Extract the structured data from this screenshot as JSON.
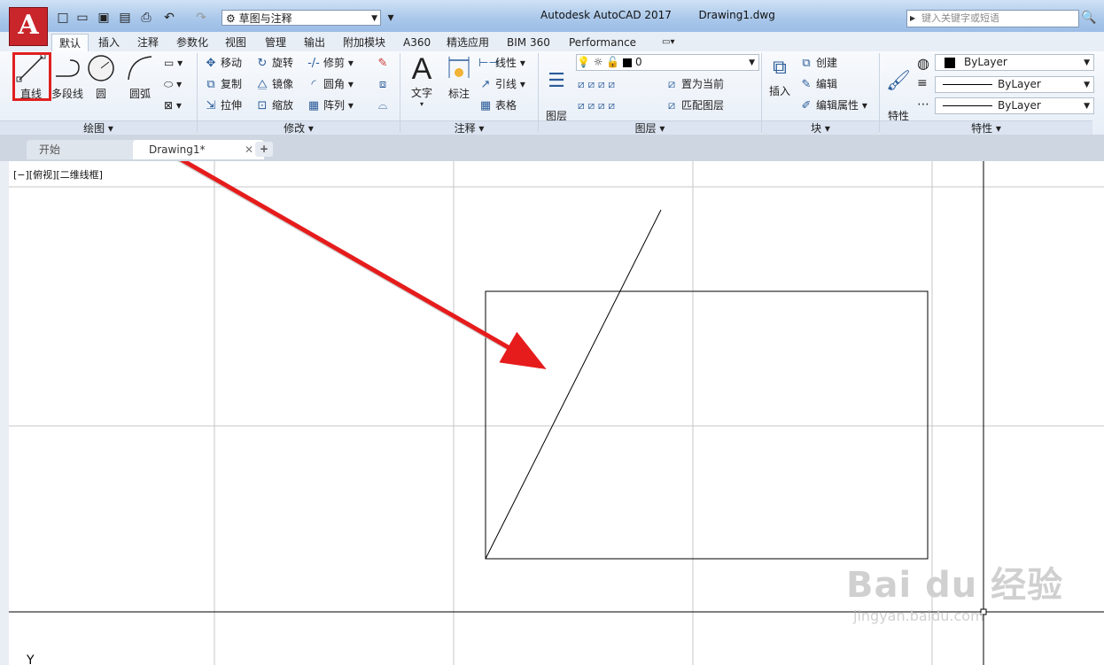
{
  "app": {
    "logo_letter": "A",
    "title": "Autodesk AutoCAD 2017",
    "document": "Drawing1.dwg",
    "workspace": "草图与注释",
    "search_placeholder": "键入关键字或短语"
  },
  "ribbon_tabs": [
    "默认",
    "插入",
    "注释",
    "参数化",
    "视图",
    "管理",
    "输出",
    "附加模块",
    "A360",
    "精选应用",
    "BIM 360",
    "Performance"
  ],
  "draw_panel": {
    "title": "绘图",
    "line": "直线",
    "polyline": "多段线",
    "circle": "圆",
    "arc": "圆弧"
  },
  "modify_panel": {
    "title": "修改",
    "move": "移动",
    "rotate": "旋转",
    "trim": "修剪",
    "copy": "复制",
    "mirror": "镜像",
    "fillet": "圆角",
    "stretch": "拉伸",
    "scale": "缩放",
    "array": "阵列"
  },
  "annotation_panel": {
    "title": "注释",
    "text": "文字",
    "dimension": "标注",
    "linear": "线性",
    "leader": "引线",
    "table": "表格"
  },
  "layers_panel": {
    "title": "图层",
    "layer_properties": "图层\n特性",
    "current_layer": "0",
    "set_current": "置为当前",
    "match_layer": "匹配图层"
  },
  "block_panel": {
    "title": "块",
    "insert": "插入",
    "create": "创建",
    "edit": "编辑",
    "edit_attributes": "编辑属性"
  },
  "properties_panel": {
    "title": "特性",
    "match": "特性\n匹配",
    "color": "ByLayer",
    "linetype": "ByLayer",
    "lineweight": "ByLayer"
  },
  "doc_tabs": {
    "start": "开始",
    "drawing": "Drawing1*"
  },
  "viewport_label": "[−][俯视][二维线框]",
  "axis_label": "Y",
  "watermark": {
    "main": "Bai du 经验",
    "sub": "jingyan.baidu.com"
  },
  "colors": {
    "highlight_box": "#e02020",
    "arrow": "#e61c1c",
    "app_red": "#c9262c"
  }
}
